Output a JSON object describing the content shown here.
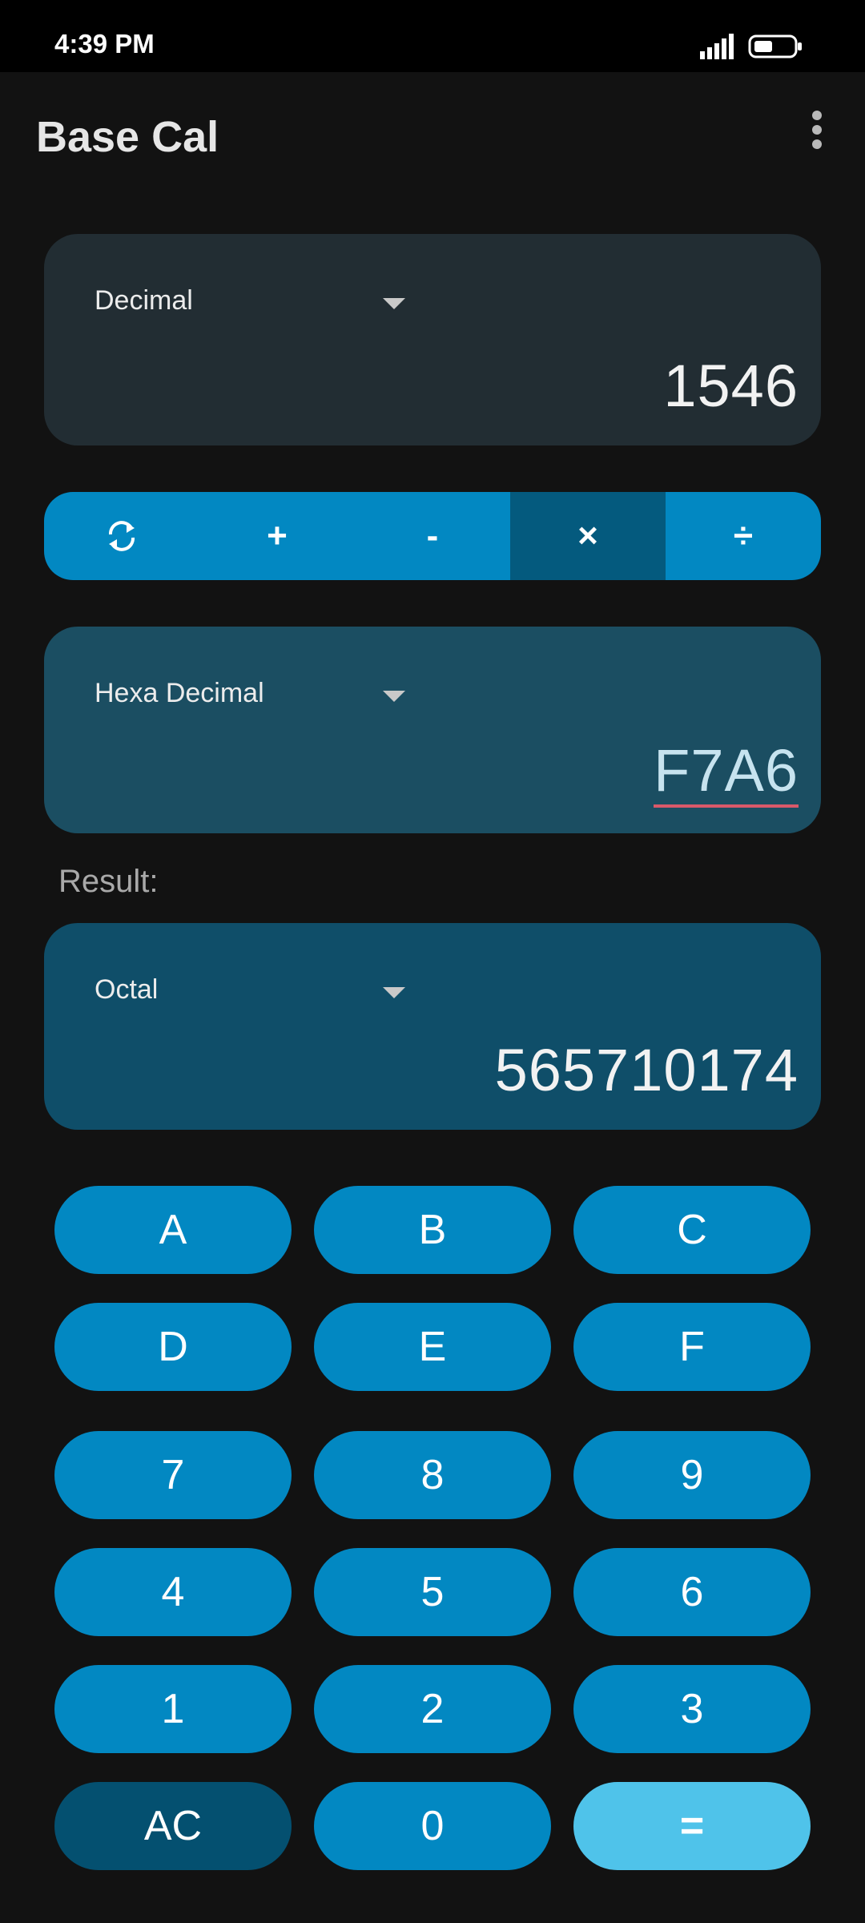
{
  "status_bar": {
    "time": "4:39 PM",
    "signal_icon": "signal-bars-icon",
    "battery_icon": "battery-icon"
  },
  "app_bar": {
    "title": "Base Cal",
    "menu_icon": "overflow-menu-icon"
  },
  "input1": {
    "base": "Decimal",
    "value": "1546"
  },
  "operations": [
    {
      "label": "⟳",
      "name": "swap-icon",
      "active": false
    },
    {
      "label": "+",
      "name": "add",
      "active": false
    },
    {
      "label": "-",
      "name": "subtract",
      "active": false
    },
    {
      "label": "×",
      "name": "multiply",
      "active": true
    },
    {
      "label": "÷",
      "name": "divide",
      "active": false
    }
  ],
  "input2": {
    "base": "Hexa Decimal",
    "value": "F7A6"
  },
  "result": {
    "label": "Result:",
    "base": "Octal",
    "value": "565710174"
  },
  "keypad": {
    "rows": [
      [
        "A",
        "B",
        "C"
      ],
      [
        "D",
        "E",
        "F"
      ],
      [
        "7",
        "8",
        "9"
      ],
      [
        "4",
        "5",
        "6"
      ],
      [
        "1",
        "2",
        "3"
      ],
      [
        "AC",
        "0",
        "="
      ]
    ]
  },
  "colors": {
    "accent": "#0288c2",
    "accent_active": "#045a7e",
    "equals": "#4fc3ea",
    "ac": "#045070"
  }
}
